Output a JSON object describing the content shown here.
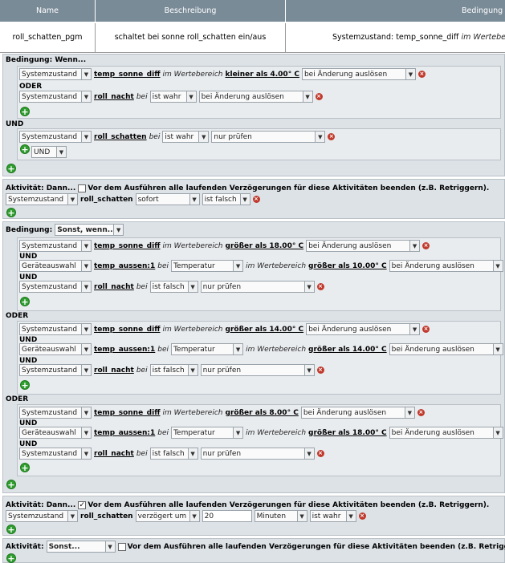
{
  "header": {
    "col_name": "Name",
    "col_desc": "Beschreibung",
    "col_cond": "Bedingung"
  },
  "program": {
    "name": "roll_schatten_pgm",
    "description": "schaltet bei sonne roll_schatten ein/aus",
    "condition_pre": "Systemzustand: temp_sonne_diff",
    "condition_it": "im Wertebereich"
  },
  "labels": {
    "cond_if": "Bedingung: Wenn...",
    "cond_else_label": "Bedingung:",
    "else_if": "Sonst, wenn...",
    "oder": "ODER",
    "und": "UND",
    "activity_then": "Aktivität: Dann...",
    "activity_label": "Aktivität:",
    "else": "Sonst...",
    "abort_text": "Vor dem Ausführen alle laufenden Verzögerungen für diese Aktivitäten beenden (z.B. Retriggern).",
    "in_range": "im Wertebereich",
    "bei": "bei"
  },
  "opts": {
    "sys": "Systemzustand",
    "dev": "Geräteauswahl",
    "on_change": "bei Änderung auslösen",
    "check_only": "nur prüfen",
    "is_true": "ist wahr",
    "is_false": "ist falsch",
    "immediately": "sofort",
    "delayed": "verzögert um",
    "minutes": "Minuten",
    "temperature": "Temperatur"
  },
  "vars": {
    "sun": "temp_sonne_diff",
    "night": "roll_nacht",
    "shade": "roll_schatten",
    "outside": "temp_aussen:1"
  },
  "values": {
    "lt4": "kleiner als 4.00° C",
    "gt18": "größer als 18.00° C",
    "gt10": "größer als 10.00° C",
    "gt14": "größer als 14.00° C",
    "gt8": "größer als 8.00° C",
    "delay": "20"
  },
  "icons": {
    "add": "plus-icon",
    "delete": "delete-icon",
    "dropdown": "chevron-down-icon"
  }
}
